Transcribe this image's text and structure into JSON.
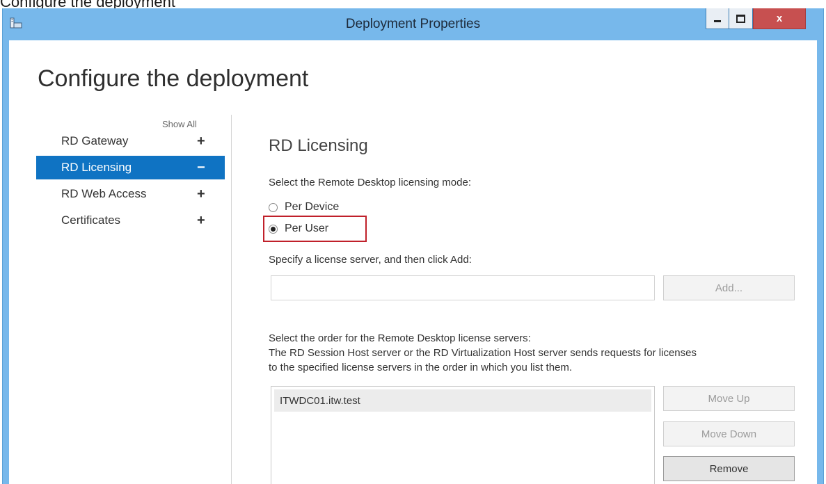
{
  "caption": "Configure the deployment",
  "window": {
    "title": "Deployment Properties",
    "close_label": "x"
  },
  "page": {
    "heading": "Configure the deployment",
    "show_all": "Show All"
  },
  "nav": {
    "items": [
      {
        "label": "RD Gateway",
        "sign": "+"
      },
      {
        "label": "RD Licensing",
        "sign": "−"
      },
      {
        "label": "RD Web Access",
        "sign": "+"
      },
      {
        "label": "Certificates",
        "sign": "+"
      }
    ],
    "selected": "RD Licensing"
  },
  "licensing": {
    "title": "RD Licensing",
    "mode_prompt": "Select the Remote Desktop licensing mode:",
    "options": [
      {
        "label": "Per Device",
        "checked": false
      },
      {
        "label": "Per User",
        "checked": true
      }
    ],
    "server_prompt": "Specify a license server, and then click Add:",
    "server_input_value": "",
    "add_button": "Add...",
    "order_prompt": "Select the order for the Remote Desktop license servers:",
    "order_desc_1": "The RD Session Host server or the RD Virtualization Host server sends requests for licenses",
    "order_desc_2": "to the specified license servers in the order in which you list them.",
    "servers": [
      "ITWDC01.itw.test"
    ],
    "move_up_button": "Move Up",
    "move_down_button": "Move Down",
    "remove_button": "Remove"
  },
  "colors": {
    "titlebar": "#77b8eb",
    "selected_nav": "#0f73c3",
    "highlight": "#c0202a",
    "close_button": "#c75050"
  }
}
